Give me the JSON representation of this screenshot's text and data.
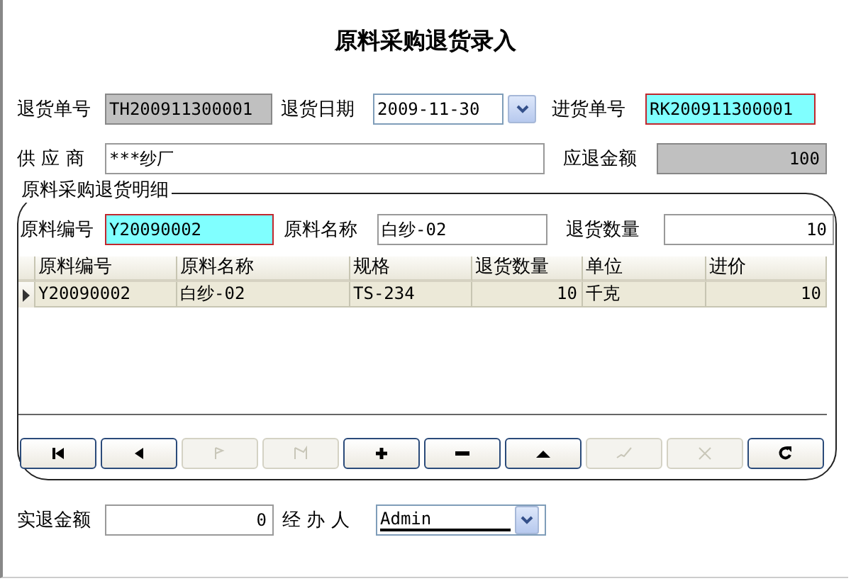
{
  "title": "原料采购退货录入",
  "header_rows": [
    [
      {
        "label": "退货单号",
        "value": "TH200911300001",
        "kind": "readonly"
      },
      {
        "label": "退货日期",
        "value": "2009-11-30",
        "kind": "date"
      },
      {
        "label": "进货单号",
        "value": "RK200911300001",
        "kind": "required"
      }
    ],
    [
      {
        "label": "供 应 商",
        "value": "***纱厂",
        "kind": "plain"
      },
      {
        "label": "应退金额",
        "value": "100",
        "kind": "readonly",
        "numeric": true
      }
    ]
  ],
  "detail": {
    "legend": "原料采购退货明细",
    "fields": [
      {
        "label": "原料编号",
        "value": "Y20090002",
        "kind": "required"
      },
      {
        "label": "原料名称",
        "value": "白纱-02",
        "kind": "plain"
      },
      {
        "label": "退货数量",
        "value": "10",
        "kind": "plain",
        "numeric": true
      }
    ],
    "table": {
      "columns": [
        {
          "name": "原料编号",
          "numeric": false
        },
        {
          "name": "原料名称",
          "numeric": false
        },
        {
          "name": "规格",
          "numeric": false
        },
        {
          "name": "退货数量",
          "numeric": true
        },
        {
          "name": "单位",
          "numeric": false
        },
        {
          "name": "进价",
          "numeric": true
        }
      ],
      "rows": [
        {
          "selected": true,
          "cells": [
            "Y20090002",
            "白纱-02",
            "TS-234",
            "10",
            "千克",
            "10"
          ]
        }
      ]
    },
    "nav_buttons": [
      {
        "kind": "first",
        "disabled": false
      },
      {
        "kind": "prev",
        "disabled": false
      },
      {
        "kind": "next",
        "disabled": true
      },
      {
        "kind": "last",
        "disabled": true
      },
      {
        "kind": "add",
        "disabled": false
      },
      {
        "kind": "delete",
        "disabled": false
      },
      {
        "kind": "edit",
        "disabled": false
      },
      {
        "kind": "post",
        "disabled": true
      },
      {
        "kind": "cancel",
        "disabled": true
      },
      {
        "kind": "refresh",
        "disabled": false
      }
    ]
  },
  "footer": [
    {
      "label": "实退金额",
      "value": "0",
      "kind": "plain",
      "numeric": true
    },
    {
      "label": "经 办 人",
      "value": "Admin",
      "kind": "combo"
    }
  ]
}
